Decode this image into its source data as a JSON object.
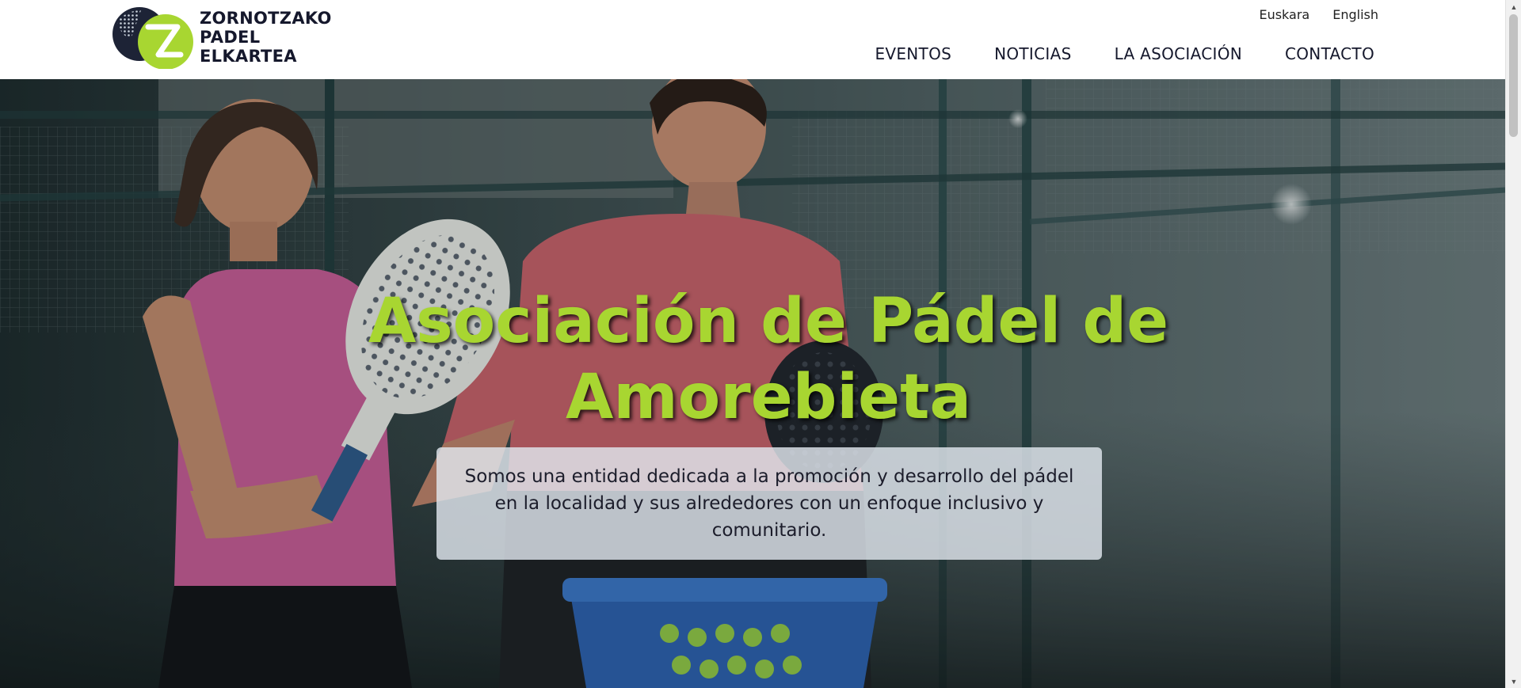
{
  "header": {
    "logo_lines": [
      "ZORNOTZAKO",
      "PADEL",
      "ELKARTEA"
    ],
    "languages": [
      "Euskara",
      "English"
    ],
    "nav": [
      "EVENTOS",
      "NOTICIAS",
      "LA ASOCIACIÓN",
      "CONTACTO"
    ]
  },
  "hero": {
    "title_line1": "Asociación de Pádel de",
    "title_line2": "Amorebieta",
    "description": "Somos una entidad dedicada a la promoción y desarrollo del pádel en la localidad y sus alrededores con un enfoque inclusivo y comunitario."
  },
  "icons": {
    "logo": "padel-racket-logo-icon",
    "scroll_up": "chevron-up-icon",
    "scroll_down": "chevron-down-icon"
  },
  "colors": {
    "accent_green": "#a8d631",
    "brand_navy": "#15182c",
    "hero_box": "#e1e6ee"
  }
}
